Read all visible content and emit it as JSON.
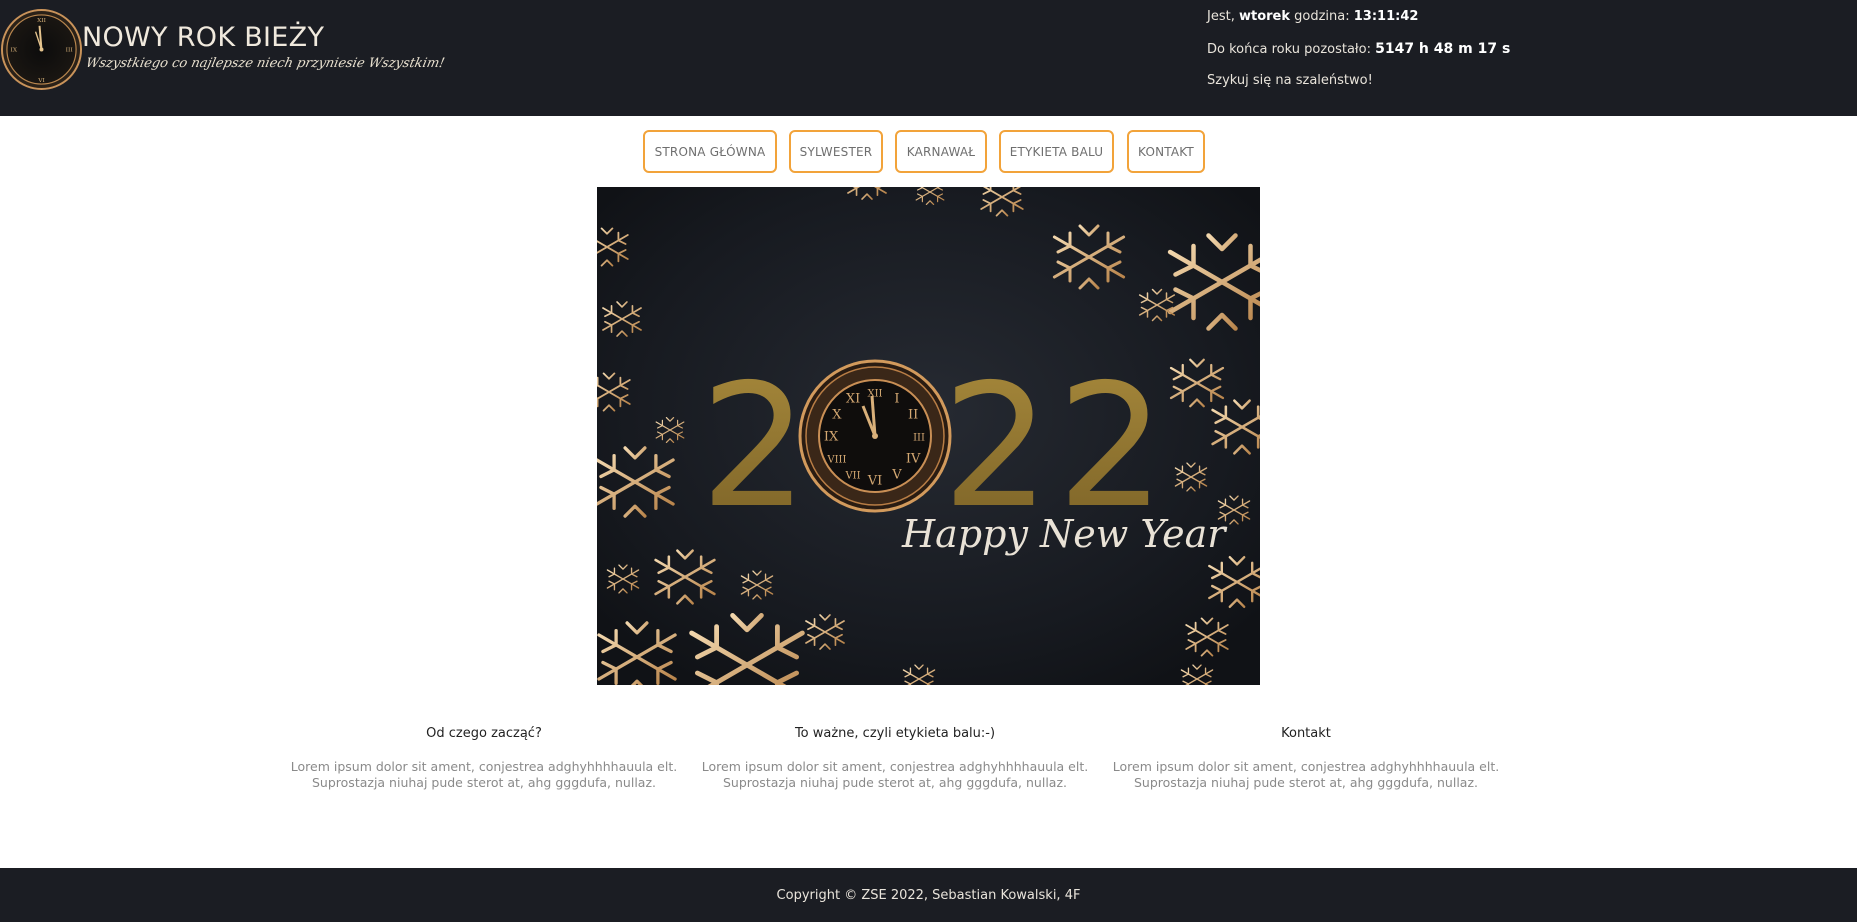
{
  "header": {
    "title": "NOWY ROK BIEŻY",
    "tagline": "Wszystkiego co najlepsze niech przyniesie Wszystkim!",
    "info": {
      "day_prefix": "Jest, ",
      "day": "wtorek",
      "time_prefix": " godzina: ",
      "time": "13:11:42",
      "remaining_prefix": "Do końca roku pozostało: ",
      "remaining": "5147 h 48 m 17 s",
      "note": "Szykuj się na szaleństwo!"
    }
  },
  "nav": {
    "items": [
      {
        "label": "STRONA GŁÓWNA"
      },
      {
        "label": "SYLWESTER"
      },
      {
        "label": "KARNAWAŁ"
      },
      {
        "label": "ETYKIETA BALU"
      },
      {
        "label": "KONTAKT"
      }
    ]
  },
  "banner": {
    "year_digits": [
      "2",
      "2",
      "2"
    ],
    "greeting": "Happy New Year",
    "clock_numerals": [
      "XII",
      "I",
      "II",
      "III",
      "IV",
      "V",
      "VI",
      "VII",
      "VIII",
      "IX",
      "X",
      "XI"
    ]
  },
  "columns": [
    {
      "heading": "Od czego zacząć?",
      "text": "Lorem ipsum dolor sit ament, conjestrea adghyhhhhauula elt.\nSuprostazja niuhaj pude sterot at, ahg gggdufa, nullaz."
    },
    {
      "heading": "To ważne, czyli etykieta balu:-)",
      "text": "Lorem ipsum dolor sit ament, conjestrea adghyhhhhauula elt.\nSuprostazja niuhaj pude sterot at, ahg gggdufa, nullaz."
    },
    {
      "heading": "Kontakt",
      "text": "Lorem ipsum dolor sit ament, conjestrea adghyhhhhauula elt.\nSuprostazja niuhaj pude sterot at, ahg gggdufa, nullaz."
    }
  ],
  "footer": {
    "copyright": "Copyright © ZSE 2022, Sebastian Kowalski, 4F"
  },
  "colors": {
    "header_bg": "#1b1d23",
    "nav_border": "#f2a33a",
    "gold": "#c9a05c"
  }
}
